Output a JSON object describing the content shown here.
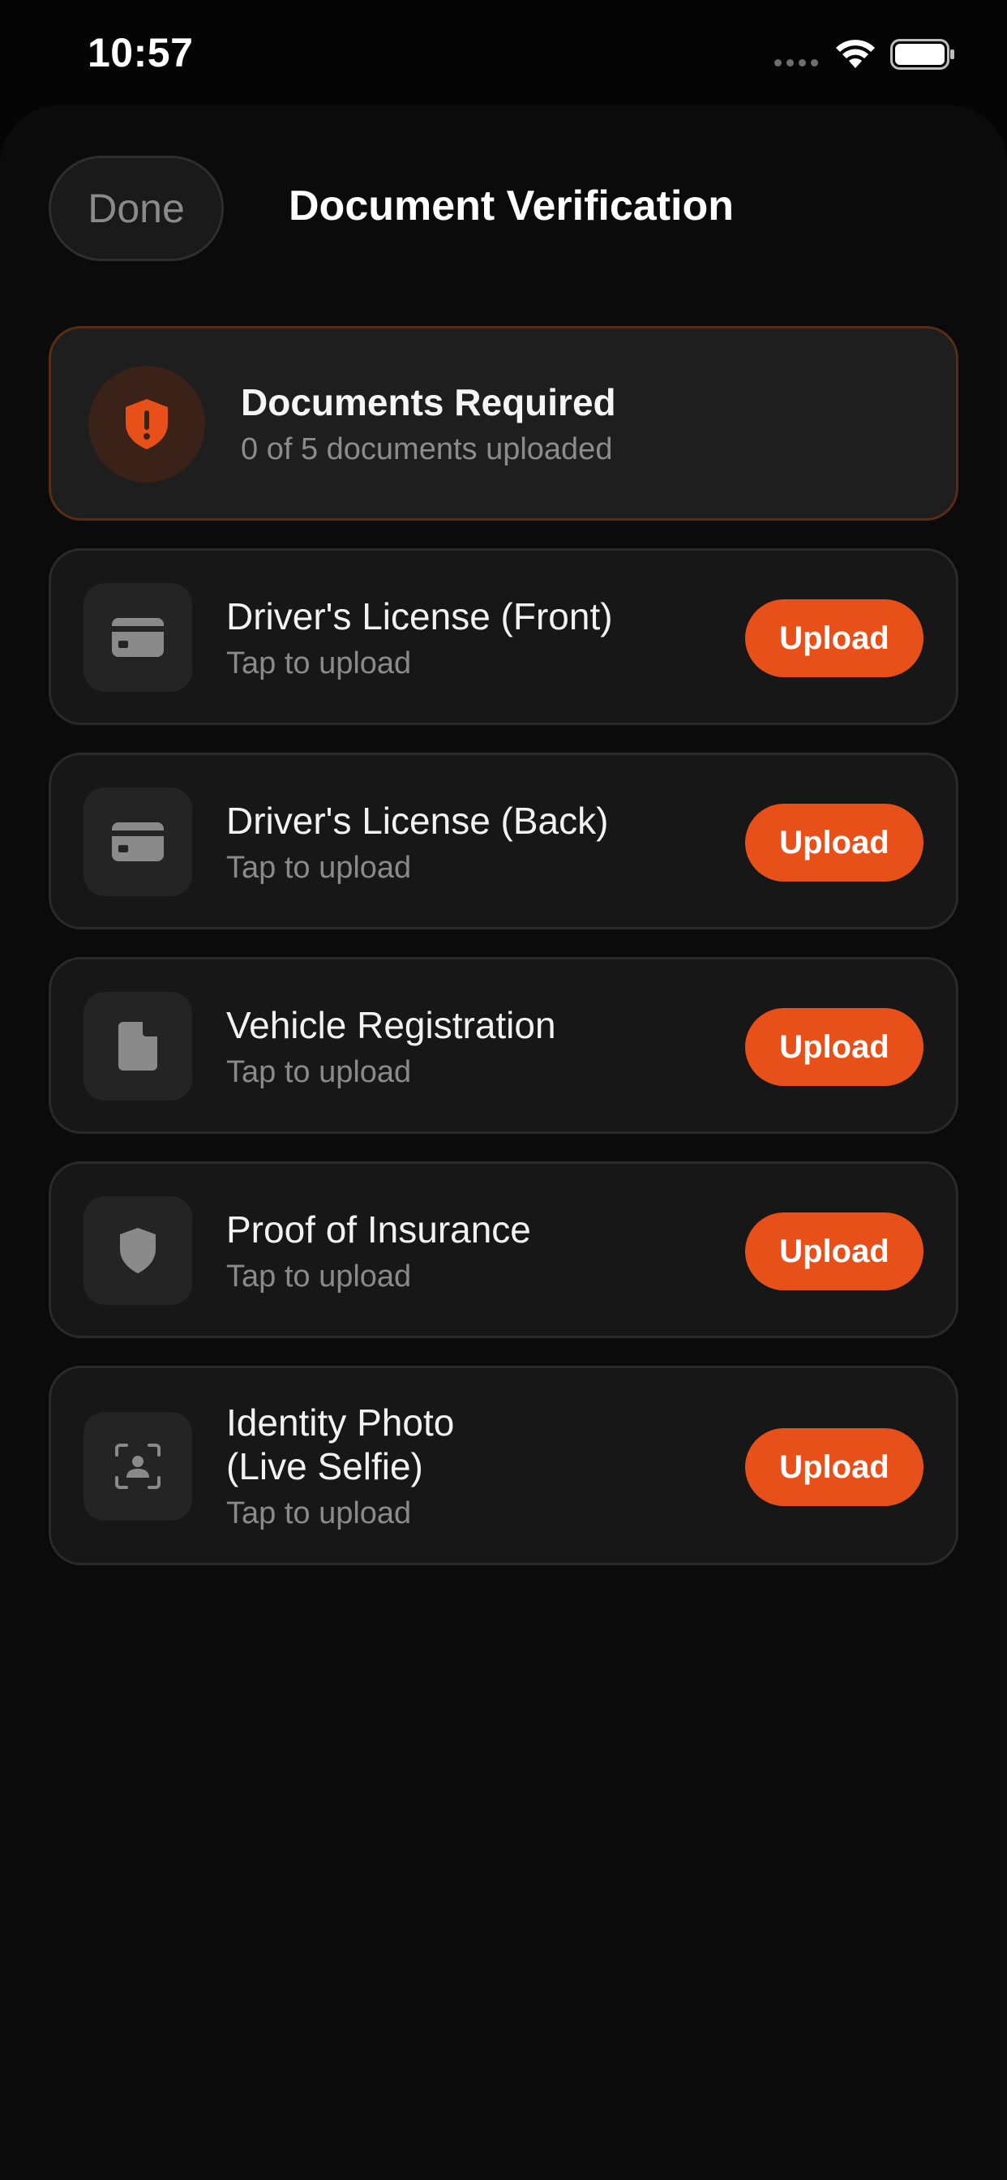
{
  "status_bar": {
    "time": "10:57"
  },
  "header": {
    "done_label": "Done",
    "title": "Document Verification"
  },
  "alert": {
    "title": "Documents Required",
    "subtitle": "0 of 5 documents uploaded",
    "icon": "shield-exclamation-icon",
    "accent_color": "#e8501a"
  },
  "documents": [
    {
      "title": "Driver's License (Front)",
      "subtitle": "Tap to upload",
      "button": "Upload",
      "icon": "card-icon"
    },
    {
      "title": "Driver's License (Back)",
      "subtitle": "Tap to upload",
      "button": "Upload",
      "icon": "card-icon"
    },
    {
      "title": "Vehicle Registration",
      "subtitle": "Tap to upload",
      "button": "Upload",
      "icon": "document-icon"
    },
    {
      "title": "Proof of Insurance",
      "subtitle": "Tap to upload",
      "button": "Upload",
      "icon": "shield-icon"
    },
    {
      "title_line1": "Identity Photo",
      "title_line2": "(Live Selfie)",
      "subtitle": "Tap to upload",
      "button": "Upload",
      "icon": "face-scan-icon"
    }
  ]
}
